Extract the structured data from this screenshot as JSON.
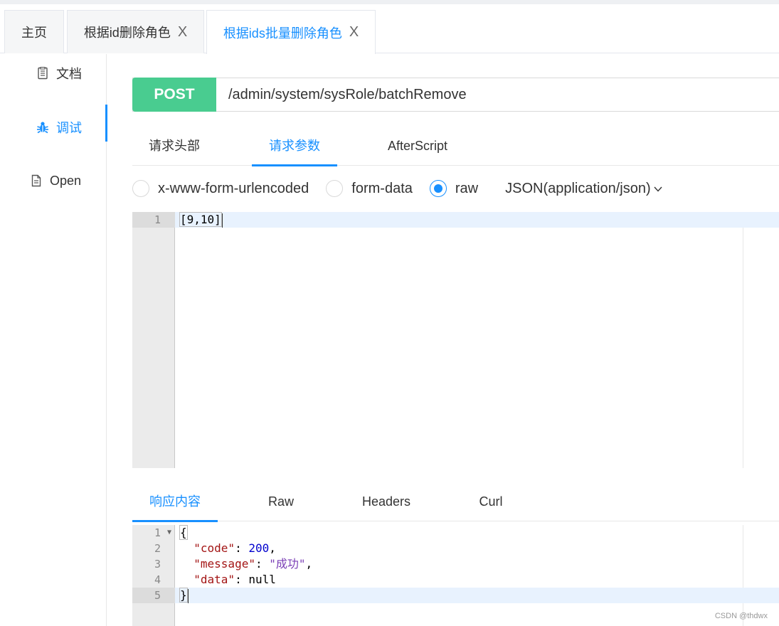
{
  "tabs": [
    {
      "label": "主页",
      "closable": false,
      "active": false
    },
    {
      "label": "根据id删除角色",
      "closable": true,
      "active": false
    },
    {
      "label": "根据ids批量删除角色",
      "closable": true,
      "active": true
    }
  ],
  "tab_close_glyph": "X",
  "sidebar": {
    "items": [
      {
        "label": "文档",
        "icon": "document-icon",
        "active": false
      },
      {
        "label": "调试",
        "icon": "bug-icon",
        "active": true
      },
      {
        "label": "Open",
        "icon": "file-icon",
        "active": false
      }
    ]
  },
  "request": {
    "method": "POST",
    "url": "/admin/system/sysRole/batchRemove",
    "method_color": "#49cc90"
  },
  "request_tabs": [
    {
      "label": "请求头部",
      "active": false
    },
    {
      "label": "请求参数",
      "active": true
    },
    {
      "label": "AfterScript",
      "active": false
    }
  ],
  "body_types": [
    {
      "label": "x-www-form-urlencoded",
      "checked": false
    },
    {
      "label": "form-data",
      "checked": false
    },
    {
      "label": "raw",
      "checked": true
    }
  ],
  "content_type": "JSON(application/json)",
  "request_body": {
    "lines": [
      "1"
    ],
    "code": "[9,10]"
  },
  "response_tabs": [
    {
      "label": "响应内容",
      "active": true
    },
    {
      "label": "Raw",
      "active": false
    },
    {
      "label": "Headers",
      "active": false
    },
    {
      "label": "Curl",
      "active": false
    }
  ],
  "response_body": {
    "line_numbers": [
      "1",
      "2",
      "3",
      "4",
      "5"
    ],
    "open_brace": "{",
    "code_key": "\"code\"",
    "code_value": "200",
    "message_key": "\"message\"",
    "message_value": "\"成功\"",
    "data_key": "\"data\"",
    "data_value": "null",
    "close_brace": "}"
  },
  "accent_color": "#1890ff",
  "watermark": "CSDN @thdwx"
}
